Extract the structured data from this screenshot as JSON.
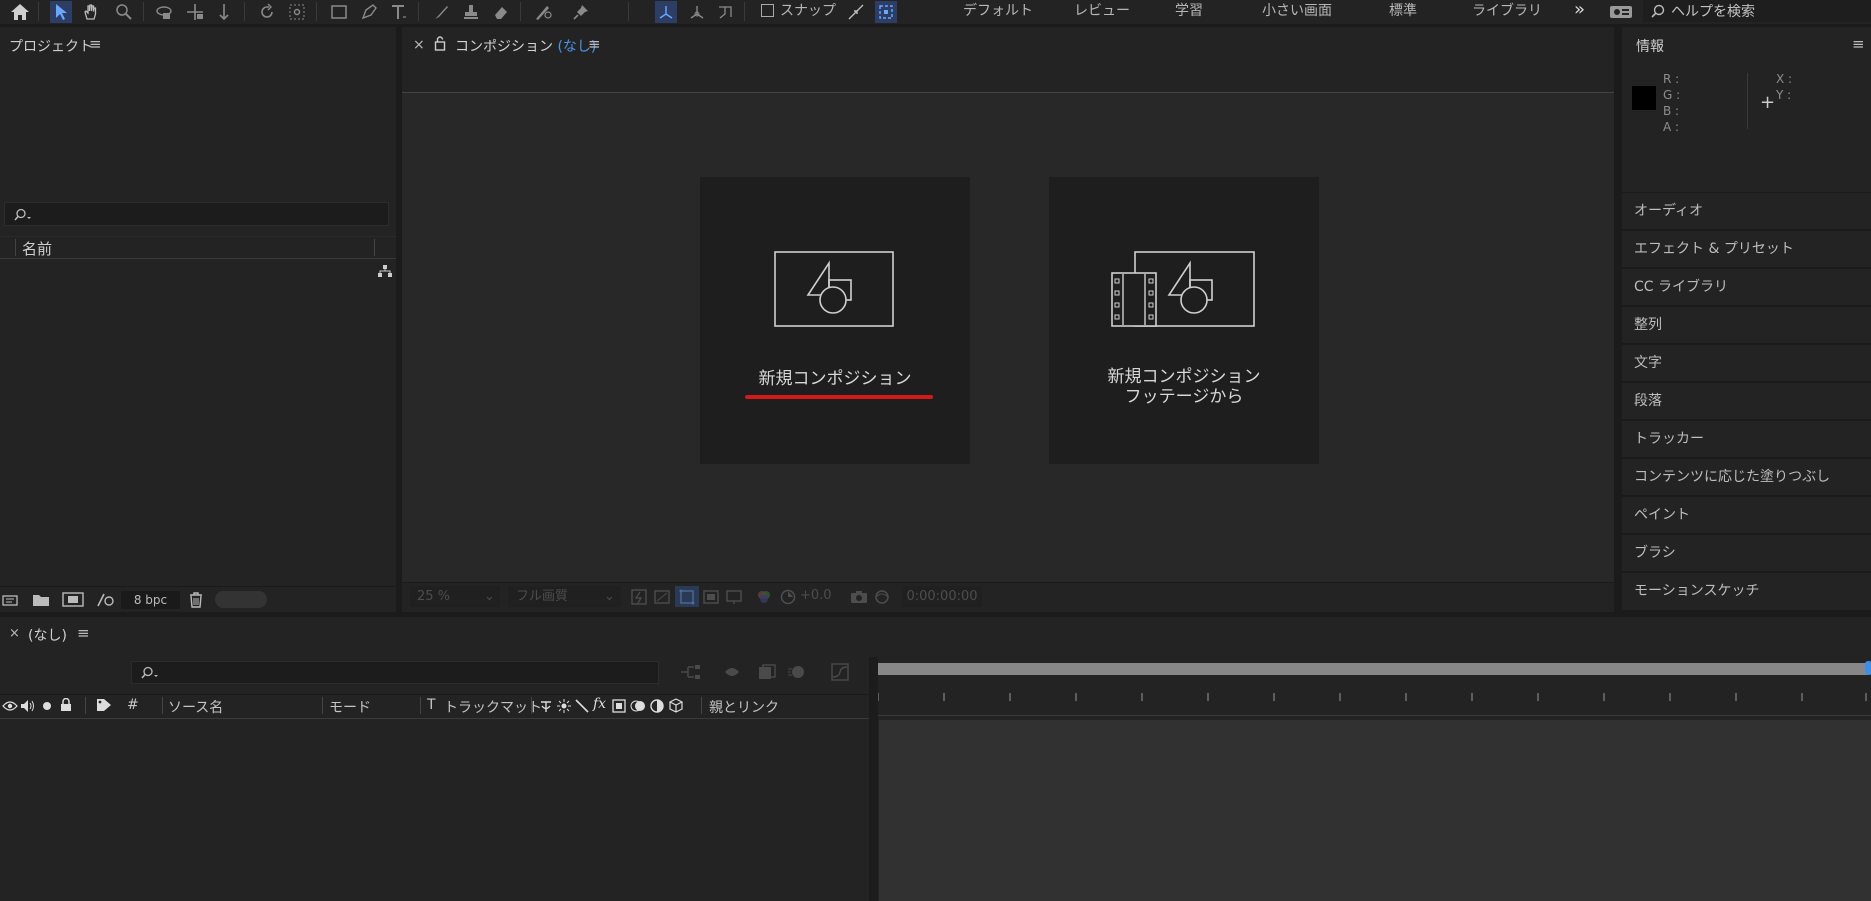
{
  "toolbar": {
    "snap_label": "スナップ",
    "workspaces": [
      "デフォルト",
      "レビュー",
      "学習",
      "小さい画面",
      "標準",
      "ライブラリ"
    ],
    "overflow": "»",
    "help_search_placeholder": "ヘルプを検索"
  },
  "project_panel": {
    "title": "プロジェクト",
    "search_value": "",
    "column_name": "名前",
    "bpc_label": "8 bpc"
  },
  "comp_panel": {
    "tab_title": "コンポジション",
    "tab_suffix": "(なし)",
    "new_comp_label": "新規コンポジション",
    "new_comp_from_footage_line1": "新規コンポジション",
    "new_comp_from_footage_line2": "フッテージから",
    "zoom_value": "25 %",
    "resolution_value": "フル画質",
    "exposure_value": "+0.0",
    "timecode": "0:00:00:00",
    "accent_color": "#3d8ee6",
    "highlight_color": "#d11a1a"
  },
  "info_panel": {
    "title": "情報",
    "r_label": "R :",
    "g_label": "G :",
    "b_label": "B :",
    "a_label": "A :",
    "x_label": "X :",
    "y_label": "Y :"
  },
  "right_panels": [
    "オーディオ",
    "エフェクト & プリセット",
    "CC ライブラリ",
    "整列",
    "文字",
    "段落",
    "トラッカー",
    "コンテンツに応じた塗りつぶし",
    "ペイント",
    "ブラシ",
    "モーションスケッチ"
  ],
  "timeline": {
    "tab_title": "(なし)",
    "search_value": "",
    "col_number": "#",
    "col_source_name": "ソース名",
    "col_mode": "モード",
    "col_t": "T",
    "col_track_matte": "トラックマット",
    "col_fx": "fx",
    "col_parent": "親とリンク"
  }
}
